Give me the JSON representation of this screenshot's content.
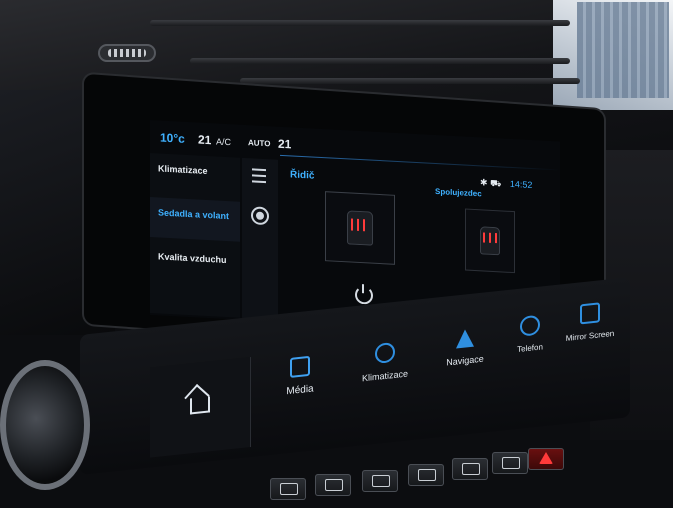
{
  "status_bar": {
    "temp_left": "10°c",
    "fan_value": "21",
    "ac_label": "A/C",
    "auto_label": "AUTO",
    "temp_right": "21",
    "time": "14:52"
  },
  "menu": {
    "items": [
      {
        "label": "Klimatizace",
        "active": false
      },
      {
        "label": "Sedadla a volant",
        "active": true
      },
      {
        "label": "Kvalita vzduchu",
        "active": false
      }
    ]
  },
  "zones": {
    "driver_title": "Řidič",
    "passenger_title": "Spolujezdec"
  },
  "shortcuts": {
    "media": "Média",
    "climate": "Klimatizace",
    "navigation": "Navigace",
    "phone": "Telefon",
    "mirror": "Mirror Screen"
  },
  "colors": {
    "accent": "#3fb1ff",
    "heat": "#ff3b3b",
    "hazard": "#ff3a3a"
  }
}
